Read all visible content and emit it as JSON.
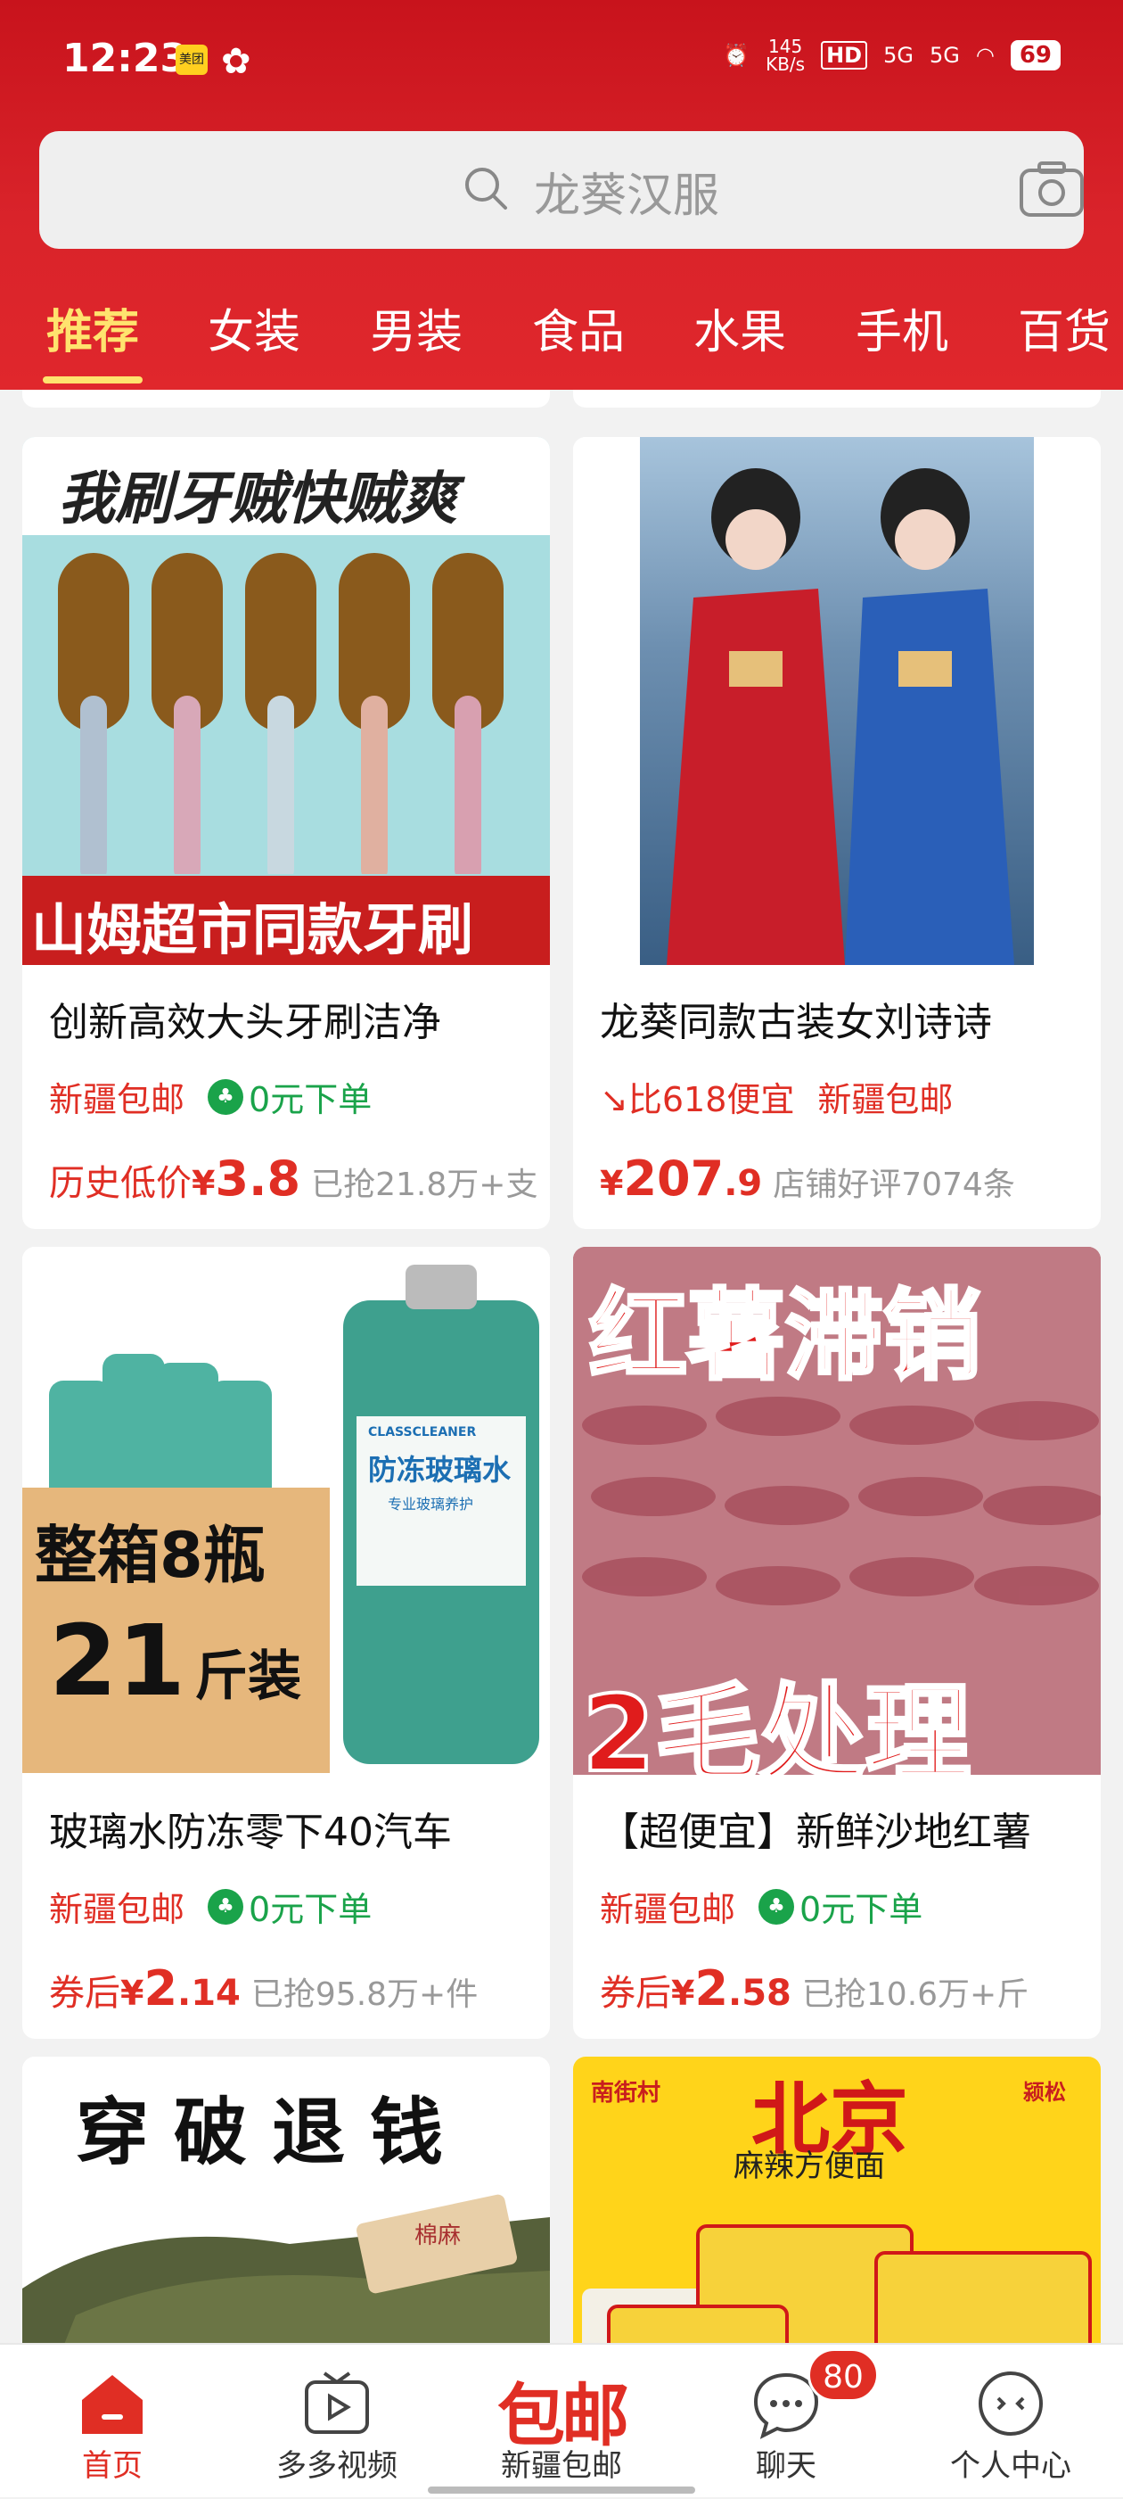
{
  "status_bar": {
    "time": "12:23",
    "app1": "美团",
    "net_speed_top": "145",
    "net_speed_bottom": "KB/s",
    "hd": "HD",
    "signal1": "5G",
    "signal2": "5G",
    "battery": "69"
  },
  "search": {
    "placeholder": "龙葵汉服"
  },
  "tabs": [
    "推荐",
    "女装",
    "男装",
    "食品",
    "水果",
    "手机",
    "百货"
  ],
  "products": [
    {
      "banner_top": "我刷牙贼快贼爽",
      "banner_bottom": "山姆超市同款牙刷",
      "title": "创新高效大头牙刷洁净",
      "tag1": "新疆包邮",
      "tag2": "0元下单",
      "price_prefix": "历史低价",
      "yen": "¥",
      "price_int": "3.8",
      "price_dec": "",
      "sold": "已抢21.8万+支"
    },
    {
      "title": "龙葵同款古装女刘诗诗",
      "tag1": "比618便宜",
      "tag2": "新疆包邮",
      "price_prefix": "",
      "yen": "¥",
      "price_int": "207",
      "price_dec": ".9",
      "sold": "店铺好评7074条"
    },
    {
      "banner_a": "整箱8瓶",
      "banner_b": "21",
      "banner_c": "斤装",
      "bottle_label_en": "CLASSCLEANER",
      "bottle_label": "防冻玻璃水",
      "bottle_sub": "专业玻璃养护",
      "title": "玻璃水防冻零下40汽车",
      "tag1": "新疆包邮",
      "tag2": "0元下单",
      "price_prefix": "券后",
      "yen": "¥",
      "price_int": "2",
      "price_dec": ".14",
      "sold": "已抢95.8万+件"
    },
    {
      "banner_top": "红薯滞销",
      "banner_bottom": "2毛处理",
      "title": "【超便宜】新鲜沙地红薯",
      "tag1": "新疆包邮",
      "tag2": "0元下单",
      "price_prefix": "券后",
      "yen": "¥",
      "price_int": "2",
      "price_dec": ".58",
      "sold": "已抢10.6万+斤"
    },
    {
      "banner_top": "穿破退钱",
      "label": "棉麻"
    },
    {
      "brand_left": "南街村",
      "banner_top": "北京",
      "banner_sub": "麻辣方便面",
      "brand_right": "颍松"
    }
  ],
  "bottom_nav": [
    {
      "label": "首页",
      "icon": "home-icon"
    },
    {
      "label": "多多视频",
      "icon": "video-icon"
    },
    {
      "label": "新疆包邮",
      "big": "包邮",
      "icon": "baoyou-icon"
    },
    {
      "label": "聊天",
      "icon": "chat-icon",
      "badge": "80"
    },
    {
      "label": "个人中心",
      "icon": "profile-icon"
    }
  ],
  "colors": {
    "brand_red": "#e02e24",
    "header_red": "#d9232a",
    "active_tab": "#ffe36e",
    "green": "#1aa34a"
  }
}
